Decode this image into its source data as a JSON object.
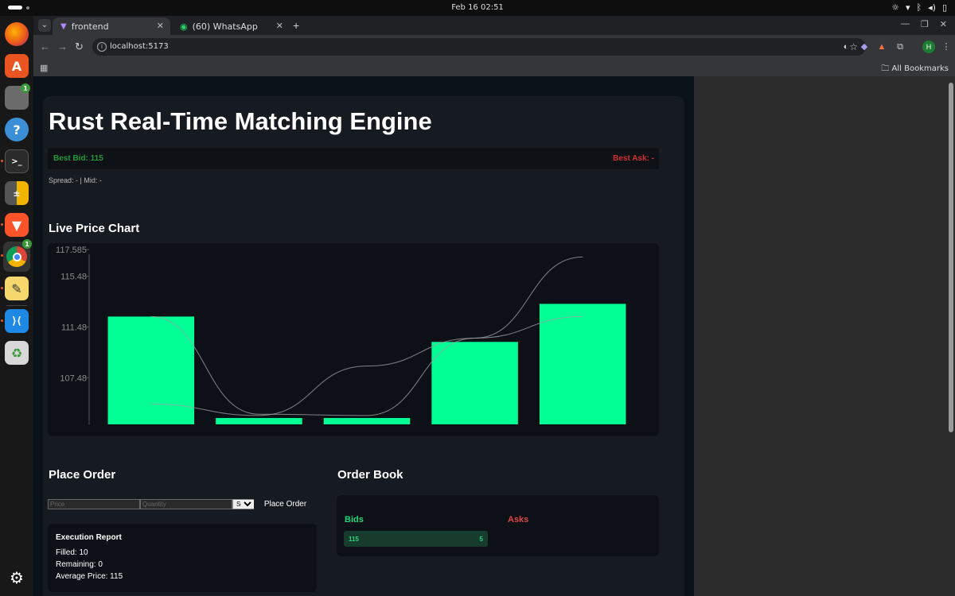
{
  "system": {
    "clock": "Feb 16  02:51",
    "tray": [
      "☼",
      "▾",
      "ᛒ",
      "◂)",
      "▯"
    ]
  },
  "browser": {
    "tabs": [
      {
        "label": "frontend",
        "active": true
      },
      {
        "label": "(60) WhatsApp",
        "active": false
      }
    ],
    "url": "localhost:5173",
    "bookmarks_label": "All Bookmarks",
    "profile_initial": "H"
  },
  "app": {
    "title": "Rust Real-Time Matching Engine",
    "best_bid": "Best Bid: 115",
    "best_ask": "Best Ask: -",
    "spread_mid": "Spread: - | Mid: -",
    "chart_heading": "Live Price Chart",
    "place_order_heading": "Place Order",
    "order_book_heading": "Order Book",
    "form": {
      "price_placeholder": "Price",
      "quantity_placeholder": "Quantity",
      "side_selected": "Sell",
      "button_label": "Place Order"
    },
    "execution_report": {
      "heading": "Execution Report",
      "filled": "Filled: 10",
      "remaining": "Remaining: 0",
      "average_price": "Average Price: 115"
    },
    "order_book": {
      "bids_label": "Bids",
      "asks_label": "Asks",
      "bids": [
        {
          "price": "115",
          "qty": "5"
        }
      ]
    }
  },
  "chart_data": {
    "type": "bar",
    "title": "",
    "xlabel": "",
    "ylabel": "",
    "ylim": [
      103.8,
      117.585
    ],
    "y_ticks": [
      "117.585",
      "115.48",
      "111.48",
      "107.48"
    ],
    "y_tick_values": [
      117.585,
      115.48,
      111.48,
      107.48
    ],
    "values": [
      112.3,
      104.3,
      104.3,
      110.3,
      113.3
    ],
    "bar_color": "#00ff95",
    "line_series": [
      {
        "name": "",
        "values": [
          112.3,
          104.6,
          104.5,
          110.6,
          117.0
        ]
      },
      {
        "name": "",
        "values": [
          105.4,
          104.5,
          108.4,
          110.6,
          112.3
        ]
      }
    ]
  }
}
